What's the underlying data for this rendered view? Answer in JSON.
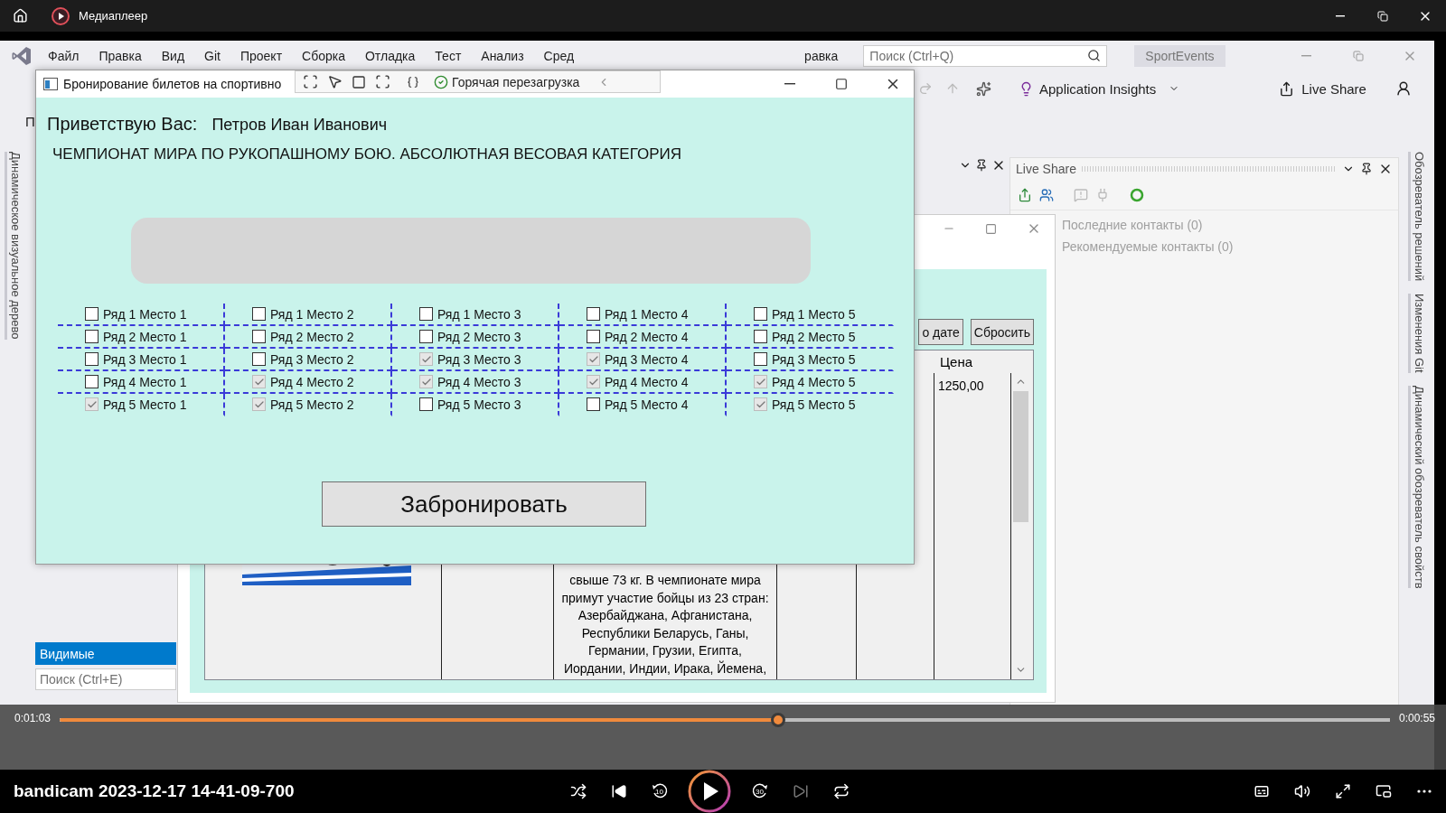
{
  "player": {
    "title": "Медиаплеер"
  },
  "ide": {
    "menu": [
      "Файл",
      "Правка",
      "Вид",
      "Git",
      "Проект",
      "Сборка",
      "Отладка",
      "Тест",
      "Анализ",
      "Сред",
      "равка"
    ],
    "search": {
      "placeholder": "Поиск (Ctrl+Q)"
    },
    "solution_name": "SportEvents",
    "toolbar": {
      "insights": "Application Insights",
      "live_share": "Live Share"
    },
    "left_fragment": "П",
    "left_tabs": [
      "Динамическое визуальное дерево"
    ],
    "right_tabs": [
      "Обозреватель решений",
      "Изменения Git",
      "Динамический обозреватель свойств"
    ],
    "live_share_panel": {
      "title": "Live Share",
      "items": [
        "Последние контакты (0)",
        "Рекомендуемые контакты (0)"
      ]
    },
    "watch_panel": {
      "tab": "Видимые",
      "search": {
        "placeholder": "Поиск (Ctrl+E)"
      }
    }
  },
  "back_window": {
    "buttons": [
      "о дате",
      "Сбросить"
    ],
    "price_header": "Цена",
    "price": "1250,00",
    "description": "свыше 73 кг. В чемпионате мира\nпримут участие бойцы из 23 стран:\nАзербайджана, Афганистана,\nРеспублики Беларусь, Ганы,\nГермании, Грузии, Египта,\nИордании, Индии, Ирака, Йемена,"
  },
  "front_window": {
    "title": "Бронирование билетов на спортивно",
    "hot_reload": "Горячая перезагрузка",
    "greeting_label": "Приветствую Вас:",
    "user_name": "Петров Иван Иванович",
    "event_title": "ЧЕМПИОНАТ МИРА ПО РУКОПАШНОМУ БОЮ. АБСОЛЮТНАЯ ВЕСОВАЯ КАТЕГОРИЯ",
    "seats": [
      {
        "label": "Ряд 1 Место 1",
        "checked": false
      },
      {
        "label": "Ряд 1 Место 2",
        "checked": false
      },
      {
        "label": "Ряд 1 Место 3",
        "checked": false
      },
      {
        "label": "Ряд 1 Место 4",
        "checked": false
      },
      {
        "label": "Ряд 1 Место 5",
        "checked": false
      },
      {
        "label": "Ряд 2 Место 1",
        "checked": false
      },
      {
        "label": "Ряд 2 Место 2",
        "checked": false
      },
      {
        "label": "Ряд 2 Место 3",
        "checked": false
      },
      {
        "label": "Ряд 2 Место 4",
        "checked": false
      },
      {
        "label": "Ряд 2 Место 5",
        "checked": false
      },
      {
        "label": "Ряд 3 Место 1",
        "checked": false
      },
      {
        "label": "Ряд 3 Место 2",
        "checked": false
      },
      {
        "label": "Ряд 3 Место 3",
        "checked": true
      },
      {
        "label": "Ряд 3 Место 4",
        "checked": true
      },
      {
        "label": "Ряд 3 Место 5",
        "checked": false
      },
      {
        "label": "Ряд 4 Место 1",
        "checked": false
      },
      {
        "label": "Ряд 4 Место 2",
        "checked": true
      },
      {
        "label": "Ряд 4 Место 3",
        "checked": true
      },
      {
        "label": "Ряд 4 Место 4",
        "checked": true
      },
      {
        "label": "Ряд 4 Место 5",
        "checked": true
      },
      {
        "label": "Ряд 5 Место 1",
        "checked": true
      },
      {
        "label": "Ряд 5 Место 2",
        "checked": true
      },
      {
        "label": "Ряд 5 Место 3",
        "checked": false
      },
      {
        "label": "Ряд 5 Место 4",
        "checked": false
      },
      {
        "label": "Ряд 5 Место 5",
        "checked": true
      }
    ],
    "book_button": "Забронировать"
  },
  "player_controls": {
    "elapsed": "0:01:03",
    "remaining": "0:00:55",
    "level": 0.54,
    "file_name": "bandicam 2023-12-17 14-41-09-700",
    "skip_back": "10",
    "skip_forward": "30"
  }
}
